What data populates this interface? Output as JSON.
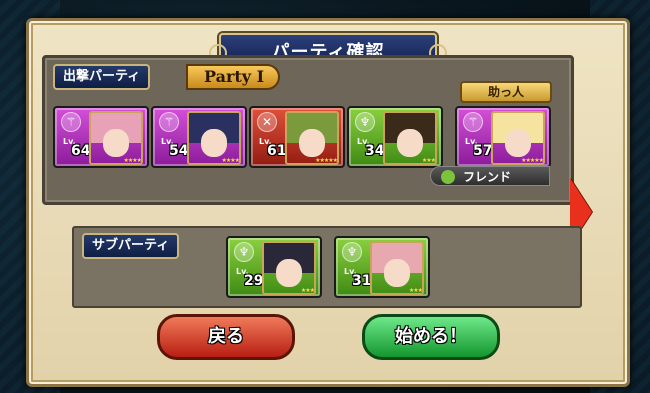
{
  "title": "パーティ確認",
  "main_party": {
    "label": "出撃パーティ",
    "name": "Party I",
    "helper_label": "助っ人",
    "cards": [
      {
        "class_icon": "staff-icon",
        "color": "purple",
        "lv_tag": "Lv.",
        "level": "64",
        "stars": "★★★★",
        "hair": "#e8a2b8"
      },
      {
        "class_icon": "staff-icon",
        "color": "purple",
        "lv_tag": "Lv.",
        "level": "54",
        "stars": "★★★★",
        "hair": "#2a3060"
      },
      {
        "class_icon": "swords-icon",
        "color": "red",
        "lv_tag": "Lv.",
        "level": "61",
        "stars": "★★★★★",
        "hair": "#7a9a3c"
      },
      {
        "class_icon": "wings-icon",
        "color": "green",
        "lv_tag": "Lv.",
        "level": "34",
        "stars": "★★★",
        "hair": "#3a2a1a"
      },
      {
        "class_icon": "staff-icon",
        "color": "purple",
        "lv_tag": "Lv.",
        "level": "57",
        "stars": "★★★★★",
        "hair": "#f4e4a0"
      }
    ],
    "friend_button": "フレンド"
  },
  "sub_party": {
    "label": "サブパーティ",
    "cards": [
      {
        "class_icon": "wings-icon",
        "color": "green",
        "lv_tag": "Lv.",
        "level": "29",
        "stars": "★★★",
        "hair": "#2a2838"
      },
      {
        "class_icon": "wings-icon",
        "color": "green",
        "lv_tag": "Lv.",
        "level": "31",
        "stars": "★★★",
        "hair": "#e8a8b0"
      }
    ]
  },
  "buttons": {
    "back": "戻る",
    "start": "始める！"
  }
}
